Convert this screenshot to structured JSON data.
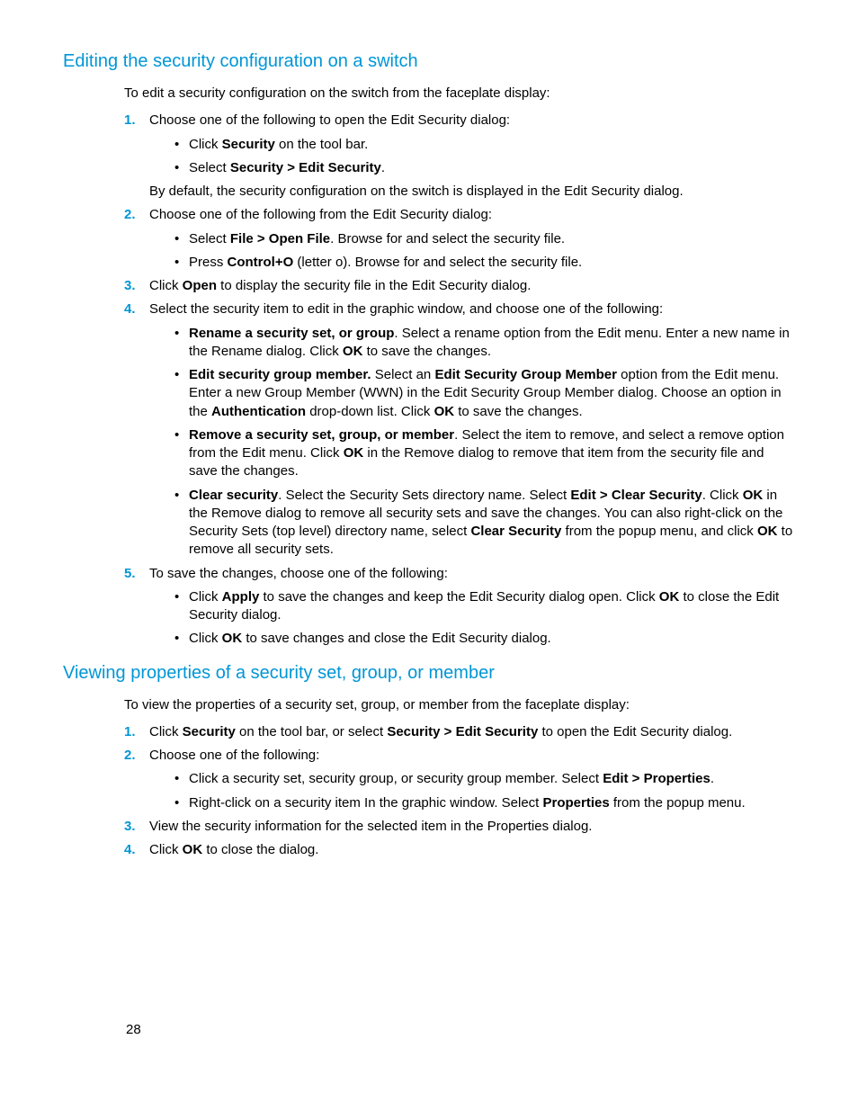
{
  "pageNumber": "28",
  "section1": {
    "heading": "Editing the security configuration on a switch",
    "intro": "To edit a security configuration on the switch from the faceplate display:",
    "step1": "Choose one of the following to open the Edit Security dialog:",
    "s1b1a": "Click ",
    "s1b1b": "Security",
    "s1b1c": " on the tool bar.",
    "s1b2a": "Select ",
    "s1b2b": "Security > Edit Security",
    "s1b2c": ".",
    "s1note": "By default, the security configuration on the switch is displayed in the Edit Security dialog.",
    "step2": "Choose one of the following from the Edit Security dialog:",
    "s2b1a": "Select ",
    "s2b1b": "File > Open File",
    "s2b1c": ". Browse for and select the security file.",
    "s2b2a": "Press ",
    "s2b2b": "Control+O",
    "s2b2c": " (letter o). Browse for and select the security file.",
    "step3a": "Click ",
    "step3b": "Open",
    "step3c": " to display the security file in the Edit Security dialog.",
    "step4": "Select the security item to edit in the graphic window, and choose one of the following:",
    "s4b1a": "Rename a security set, or group",
    "s4b1b": ". Select a rename option from the Edit menu. Enter a new name in the Rename dialog. Click ",
    "s4b1c": "OK",
    "s4b1d": " to save the changes.",
    "s4b2a": "Edit security group member.",
    "s4b2b": " Select an ",
    "s4b2c": "Edit Security Group Member",
    "s4b2d": " option from the Edit menu. Enter a new Group Member (WWN) in the Edit Security Group Member dialog. Choose an option in the ",
    "s4b2e": "Authentication",
    "s4b2f": " drop-down list. Click ",
    "s4b2g": "OK",
    "s4b2h": " to save the changes.",
    "s4b3a": "Remove a security set, group, or member",
    "s4b3b": ". Select the item to remove, and select a remove option from the Edit menu. Click ",
    "s4b3c": "OK",
    "s4b3d": " in the Remove dialog to remove that item from the security file and save the changes.",
    "s4b4a": "Clear security",
    "s4b4b": ". Select the Security Sets directory name. Select ",
    "s4b4c": "Edit > Clear Security",
    "s4b4d": ". Click ",
    "s4b4e": "OK",
    "s4b4f": " in the Remove dialog to remove all security sets and save the changes. You can also right-click on the Security Sets (top level) directory name, select ",
    "s4b4g": "Clear Security",
    "s4b4h": " from the popup menu, and click ",
    "s4b4i": "OK",
    "s4b4j": " to remove all security sets.",
    "step5": "To save the changes, choose one of the following:",
    "s5b1a": "Click ",
    "s5b1b": "Apply",
    "s5b1c": " to save the changes and keep the Edit Security dialog open. Click ",
    "s5b1d": "OK",
    "s5b1e": " to close the Edit Security dialog.",
    "s5b2a": "Click ",
    "s5b2b": "OK",
    "s5b2c": " to save changes and close the Edit Security dialog."
  },
  "section2": {
    "heading": "Viewing properties of a security set, group, or member",
    "intro": "To view the properties of a security set, group, or member from the faceplate display:",
    "step1a": "Click ",
    "step1b": "Security",
    "step1c": " on the tool bar, or select ",
    "step1d": "Security > Edit Security",
    "step1e": " to open the Edit Security dialog.",
    "step2": "Choose one of the following:",
    "s2b1a": "Click a security set, security group, or security group member. Select ",
    "s2b1b": "Edit > Properties",
    "s2b1c": ".",
    "s2b2a": "Right-click on a security item In the graphic window. Select ",
    "s2b2b": "Properties",
    "s2b2c": " from the popup menu.",
    "step3": "View the security information for the selected item in the Properties dialog.",
    "step4a": "Click ",
    "step4b": "OK",
    "step4c": " to close the dialog."
  }
}
